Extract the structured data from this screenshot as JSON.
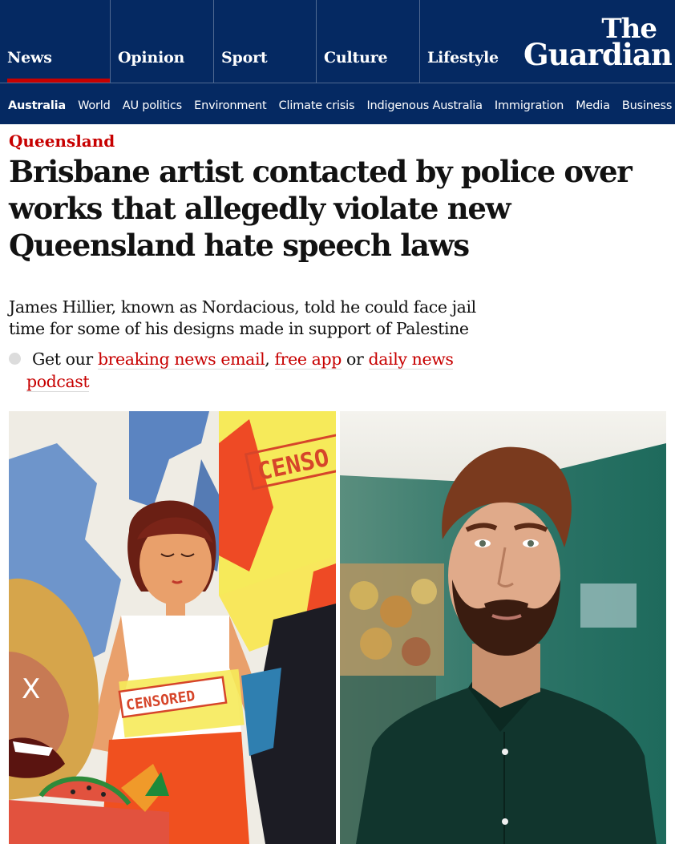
{
  "colors": {
    "brand_blue": "#052962",
    "news_red": "#c70000",
    "text": "#121212"
  },
  "masthead": {
    "pillars": [
      "News",
      "Opinion",
      "Sport",
      "Culture",
      "Lifestyle"
    ],
    "active_pillar": "News",
    "logo_line1": "The",
    "logo_line2": "Guardian"
  },
  "subnav": {
    "items": [
      "Australia",
      "World",
      "AU politics",
      "Environment",
      "Climate crisis",
      "Indigenous Australia",
      "Immigration",
      "Media",
      "Business"
    ],
    "active": "Australia"
  },
  "article": {
    "kicker": "Queensland",
    "headline": "Brisbane artist contacted by police over works that allegedly violate new Queensland hate speech laws",
    "standfirst": "James Hillier, known as Nordacious, told he could face jail time for some of his designs made in support of Palestine",
    "cta": {
      "prefix": "Get our ",
      "link1": "breaking news email",
      "sep1": ", ",
      "link2": "free app",
      "sep2": " or ",
      "link3_part1": "daily news",
      "link3_part2": "podcast"
    }
  },
  "images": {
    "artwork_stamp_top": "CENSO",
    "artwork_stamp_shirt": "CENSORED",
    "artwork_x_mark": "X"
  }
}
